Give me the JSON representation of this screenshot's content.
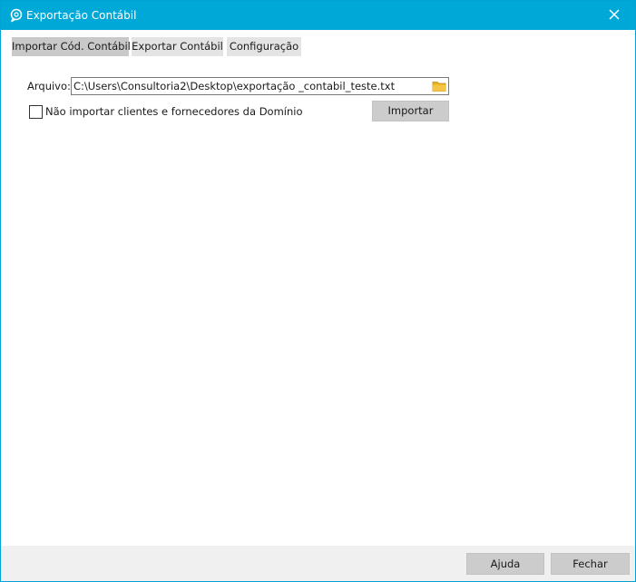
{
  "window": {
    "title": "Exportação Contábil",
    "title_bar_color": "#00a8d8",
    "app_icon": "chat-bubble-icon",
    "close_icon": "close-icon"
  },
  "tabs": [
    {
      "label": "Importar Cód. Contábil",
      "active": true
    },
    {
      "label": "Exportar Contábil",
      "active": false
    },
    {
      "label": "Configuração",
      "active": false
    }
  ],
  "import_panel": {
    "file_label": "Arquivo:",
    "file_value": "C:\\Users\\Consultoria2\\Desktop\\exportação _contabil_teste.txt",
    "browse_icon": "folder-icon",
    "checkbox_label": "Não importar clientes e fornecedores da Domínio",
    "checkbox_checked": false,
    "import_button_label": "Importar"
  },
  "footer": {
    "help_button_label": "Ajuda",
    "close_button_label": "Fechar"
  }
}
